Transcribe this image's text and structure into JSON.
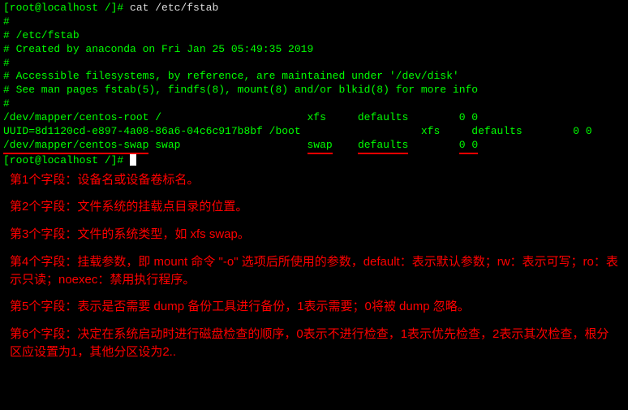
{
  "terminal": {
    "prompt1": "[root@localhost /]# ",
    "cmd1": "cat /etc/fstab",
    "blank": "",
    "comment1": "#",
    "comment2": "# /etc/fstab",
    "comment3": "# Created by anaconda on Fri Jan 25 05:49:35 2019",
    "comment4": "#",
    "comment5": "# Accessible filesystems, by reference, are maintained under '/dev/disk'",
    "comment6": "# See man pages fstab(5), findfs(8), mount(8) and/or blkid(8) for more info",
    "comment7": "#",
    "entry1_a": "/dev/mapper/centos-root /                       xfs     defaults        0 0",
    "entry2_a": "UUID=8d1120cd-e897-4a08-86a6-04c6c917b8bf /boot                   xfs     defaults        0 0",
    "entry3_dev": "/dev/mapper/centos-swap",
    "entry3_swap1": "swap",
    "entry3_swap2": "swap",
    "entry3_defaults": "defaults",
    "entry3_nums": "0 0",
    "prompt2": "[root@localhost /]# "
  },
  "notes": {
    "f1": "第1个字段：设备名或设备卷标名。",
    "f2": "第2个字段：文件系统的挂载点目录的位置。",
    "f3": "第3个字段：文件的系统类型，如 xfs  swap。",
    "f4": "第4个字段：挂载参数，即 mount 命令 \"-o\" 选项后所使用的参数，default：表示默认参数；rw：表示可写；ro：表示只读；noexec：禁用执行程序。",
    "f5": "第5个字段：表示是否需要 dump 备份工具进行备份，1表示需要；0将被 dump 忽略。",
    "f6": "第6个字段：决定在系统启动时进行磁盘检查的顺序，0表示不进行检查，1表示优先检查，2表示其次检查，根分区应设置为1，其他分区设为2.."
  }
}
